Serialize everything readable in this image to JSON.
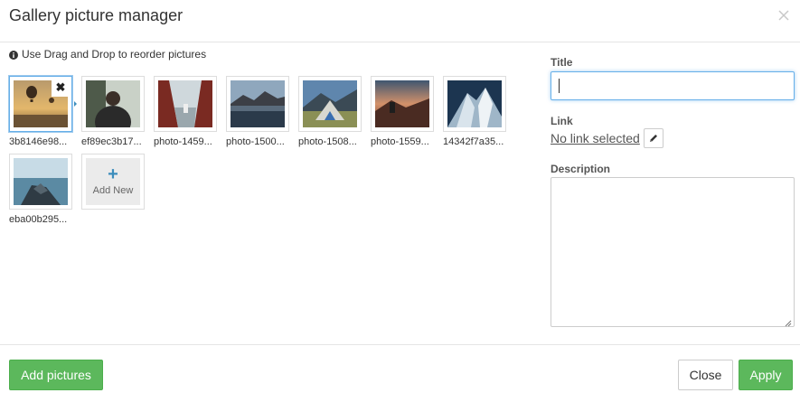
{
  "dialog": {
    "title": "Gallery picture manager",
    "close_icon": "close-icon"
  },
  "hint": {
    "icon": "info-icon",
    "text": "Use Drag and Drop to reorder pictures"
  },
  "pictures": [
    {
      "caption": "3b8146e98...",
      "selected": true,
      "remove_label": "✖"
    },
    {
      "caption": "ef89ec3b17..."
    },
    {
      "caption": "photo-1459..."
    },
    {
      "caption": "photo-1500..."
    },
    {
      "caption": "photo-1508..."
    },
    {
      "caption": "photo-1559..."
    },
    {
      "caption": "14342f7a35..."
    },
    {
      "caption": "eba00b295..."
    }
  ],
  "add_new": {
    "plus": "+",
    "label": "Add New"
  },
  "form": {
    "title_label": "Title",
    "title_value": "",
    "link_label": "Link",
    "link_text": "No link selected",
    "edit_icon": "pencil-icon",
    "description_label": "Description",
    "description_value": ""
  },
  "footer": {
    "add_pictures": "Add pictures",
    "close": "Close",
    "apply": "Apply"
  },
  "colors": {
    "success": "#5cb85c",
    "focus": "#66afe9",
    "accent": "#3c8dbc"
  }
}
